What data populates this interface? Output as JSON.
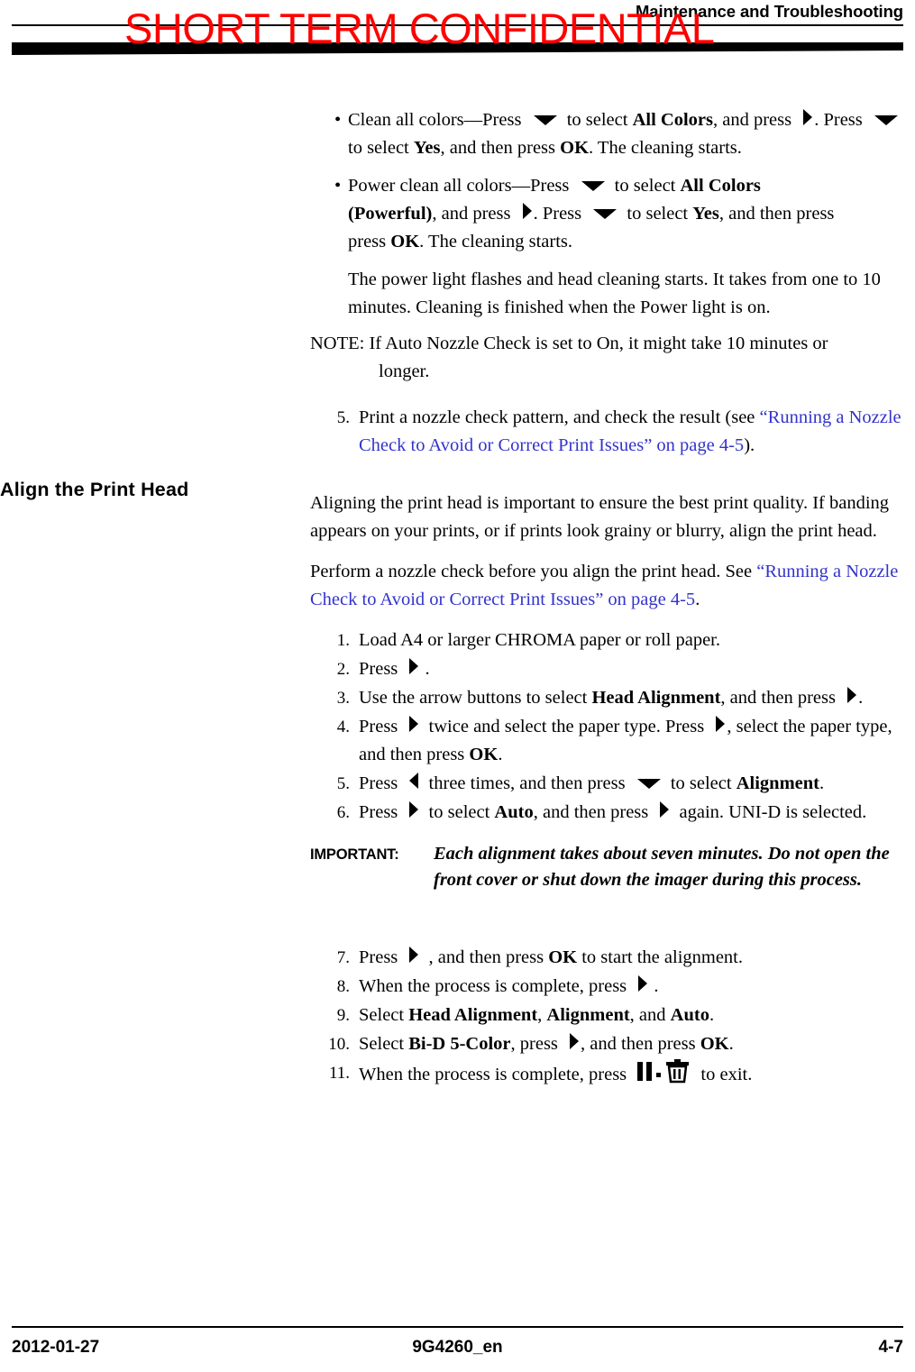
{
  "header": {
    "title": "Maintenance and Troubleshooting",
    "watermark": "SHORT TERM CONFIDENTIAL"
  },
  "footer": {
    "date": "2012-01-27",
    "doc_number": "9G4260_en",
    "page_number": "4-7"
  },
  "section": {
    "heading": "Align the Print Head"
  },
  "top_bullets": [
    {
      "seg1": "Clean all colors—Press",
      "icon1": "down-arrow-icon",
      "seg2": "to select",
      "bold1": "All Colors",
      "seg3": ", and press",
      "icon2": "right-arrow-icon",
      "seg4": ". Press",
      "icon3": "down-arrow-icon",
      "seg5": "to select",
      "bold2": "Yes",
      "seg6": ", and then press",
      "bold3": "OK",
      "seg7": ". The cleaning starts."
    },
    {
      "seg1": "Power clean all colors—Press",
      "icon1": "down-arrow-icon",
      "seg2": "to select",
      "bold1": "All Colors",
      "bold2": "(Powerful)",
      "seg3": ", and press",
      "icon2": "right-arrow-icon",
      "seg4": ". Press",
      "icon3": "down-arrow-icon",
      "seg5": "to select",
      "bold3": "Yes",
      "seg6": ", and then press",
      "bold4": "OK",
      "seg7": ". The cleaning starts."
    }
  ],
  "after_bullets": {
    "paragraph": "The power light flashes and head cleaning starts. It takes from one to 10 minutes. Cleaning is finished when the Power light is on.",
    "note_label": "NOTE:",
    "note_text": "If Auto Nozzle Check is set to On, it might take 10 minutes or",
    "note_text_2": "longer."
  },
  "step5_top": {
    "number": "5.",
    "text": "Print a nozzle check pattern, and check the result (see",
    "link": "“Running a Nozzle Check to Avoid or Correct Print Issues” on page 4-5",
    "tail": ")."
  },
  "align_intro": {
    "para1": "Aligning the print head is important to ensure the best print quality. If banding appears on your prints, or if prints look grainy or blurry, align the print head.",
    "para2_lead": "Perform a nozzle check before you align the print head. See",
    "para2_link": "“Running a Nozzle Check to Avoid or Correct Print Issues” on page 4-5",
    "para2_tail": "."
  },
  "steps": [
    {
      "number": "1.",
      "text": "Load A4 or larger CHROMA paper or roll paper."
    },
    {
      "number": "2.",
      "pre": "Press",
      "icon": "right-arrow-icon",
      "post": "."
    },
    {
      "number": "3.",
      "pre": "Use the arrow buttons to select",
      "bold": "Head Alignment",
      "mid": ", and then press",
      "icon": "right-arrow-icon",
      "post": "."
    },
    {
      "number": "4.",
      "pre": "Press",
      "icon1": "right-arrow-icon",
      "mid1": "twice and select the paper type. Press",
      "icon2": "right-arrow-icon",
      "mid2": ", select the paper type, and then press",
      "bold": "OK",
      "post": "."
    },
    {
      "number": "5.",
      "pre": "Press",
      "icon1": "left-arrow-icon",
      "mid1": "three times, and then press",
      "icon2": "down-arrow-icon",
      "mid2": "to select",
      "bold": "Alignment",
      "post": "."
    },
    {
      "number": "6.",
      "pre": "Press",
      "icon1": "right-arrow-icon",
      "mid1": "to select",
      "bold": "Auto",
      "mid2": ", and then press",
      "icon2": "right-arrow-icon",
      "post": "again. UNI-D is selected."
    }
  ],
  "important": {
    "label": "IMPORTANT:",
    "text": "Each alignment takes about seven minutes. Do not open the front cover or shut down the imager during this process."
  },
  "steps2": [
    {
      "number": "7.",
      "pre": "Press",
      "icon": "right-arrow-icon",
      "mid": ", and then press",
      "bold": "OK",
      "post": "to start the alignment."
    },
    {
      "number": "8.",
      "pre": "When the process is complete, press",
      "icon": "right-arrow-icon",
      "post": "."
    },
    {
      "number": "9.",
      "pre": "Select",
      "bold1": "Head Alignment",
      "sep1": ",",
      "bold2": "Alignment",
      "sep2": ", and",
      "bold3": "Auto",
      "post": "."
    },
    {
      "number": "10.",
      "pre": "Select",
      "bold1": "Bi-D 5-Color",
      "mid": ", press",
      "icon": "right-arrow-icon",
      "mid2": ", and then press",
      "bold2": "OK",
      "post": "."
    },
    {
      "number": "11.",
      "pre": "When the process is complete, press",
      "icon": "pause-trash-exit-icon",
      "post": "to exit."
    }
  ]
}
